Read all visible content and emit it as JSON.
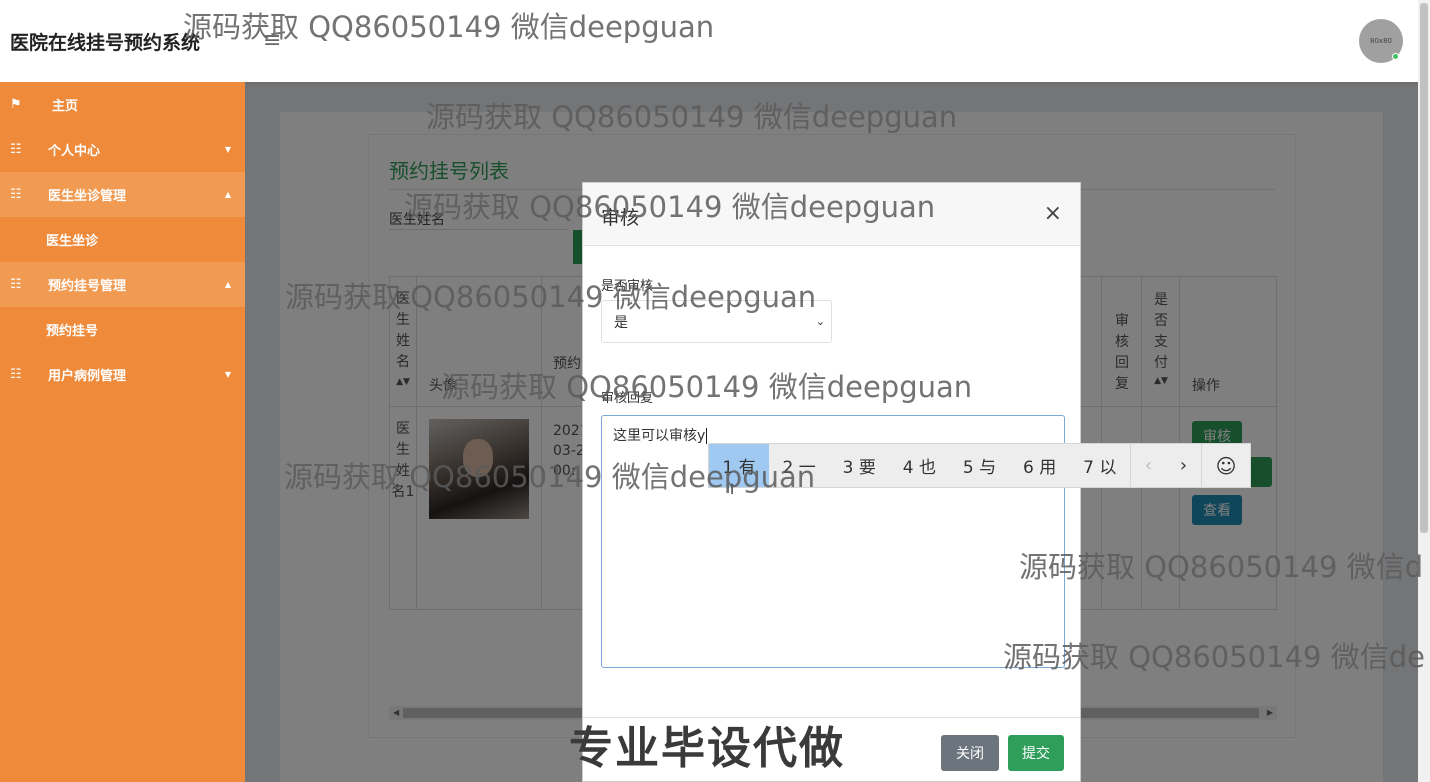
{
  "app": {
    "title": "医院在线挂号预约系统",
    "menu_icon": "≡",
    "avatar_text": "80x80"
  },
  "sidebar": {
    "items": [
      {
        "label": "主页",
        "icon": "flag-icon"
      },
      {
        "label": "个人中心",
        "icon": "grid-icon"
      },
      {
        "label": "医生坐诊管理",
        "icon": "grid-icon",
        "sub": "医生坐诊"
      },
      {
        "label": "预约挂号管理",
        "icon": "grid-icon",
        "sub": "预约挂号"
      },
      {
        "label": "用户病例管理",
        "icon": "grid-icon"
      }
    ]
  },
  "list": {
    "title": "预约挂号列表",
    "search_label": "医生姓名",
    "columns": {
      "doctor_name": "医生姓名",
      "avatar": "头像",
      "appointment": "预约",
      "review_reply": "审核回复",
      "is_paid": "是否支付",
      "actions": "操作"
    },
    "row": {
      "doctor_name": "医生姓名1",
      "date_lines": [
        "2021",
        "03-2",
        "00:"
      ]
    },
    "actions": {
      "review": "审核",
      "view": "查看"
    }
  },
  "modal": {
    "title": "审核",
    "close_symbol": "×",
    "approve_label": "是否审核",
    "approve_value": "是",
    "reply_label": "审核回复",
    "reply_text": "这里可以审核y",
    "close_button": "关闭",
    "submit_button": "提交"
  },
  "ime": {
    "candidates": [
      "1 有",
      "2 一",
      "3 要",
      "4 也",
      "5 与",
      "6 用",
      "7 以"
    ],
    "prev": "‹",
    "next": "›",
    "emoji": "☺"
  },
  "watermarks": {
    "text": "源码获取 QQ86050149 微信deepguan",
    "text_cut1": "源码获取 QQ86050149 微信d",
    "text_cut2": "源码获取 QQ86050149 微信de",
    "bottom": "专业毕设代做"
  },
  "colors": {
    "sidebar": "#ee8a3a",
    "accent_green": "#2e9e5a",
    "accent_blue": "#1f8db5",
    "ime_selected": "#9fc9f0"
  }
}
